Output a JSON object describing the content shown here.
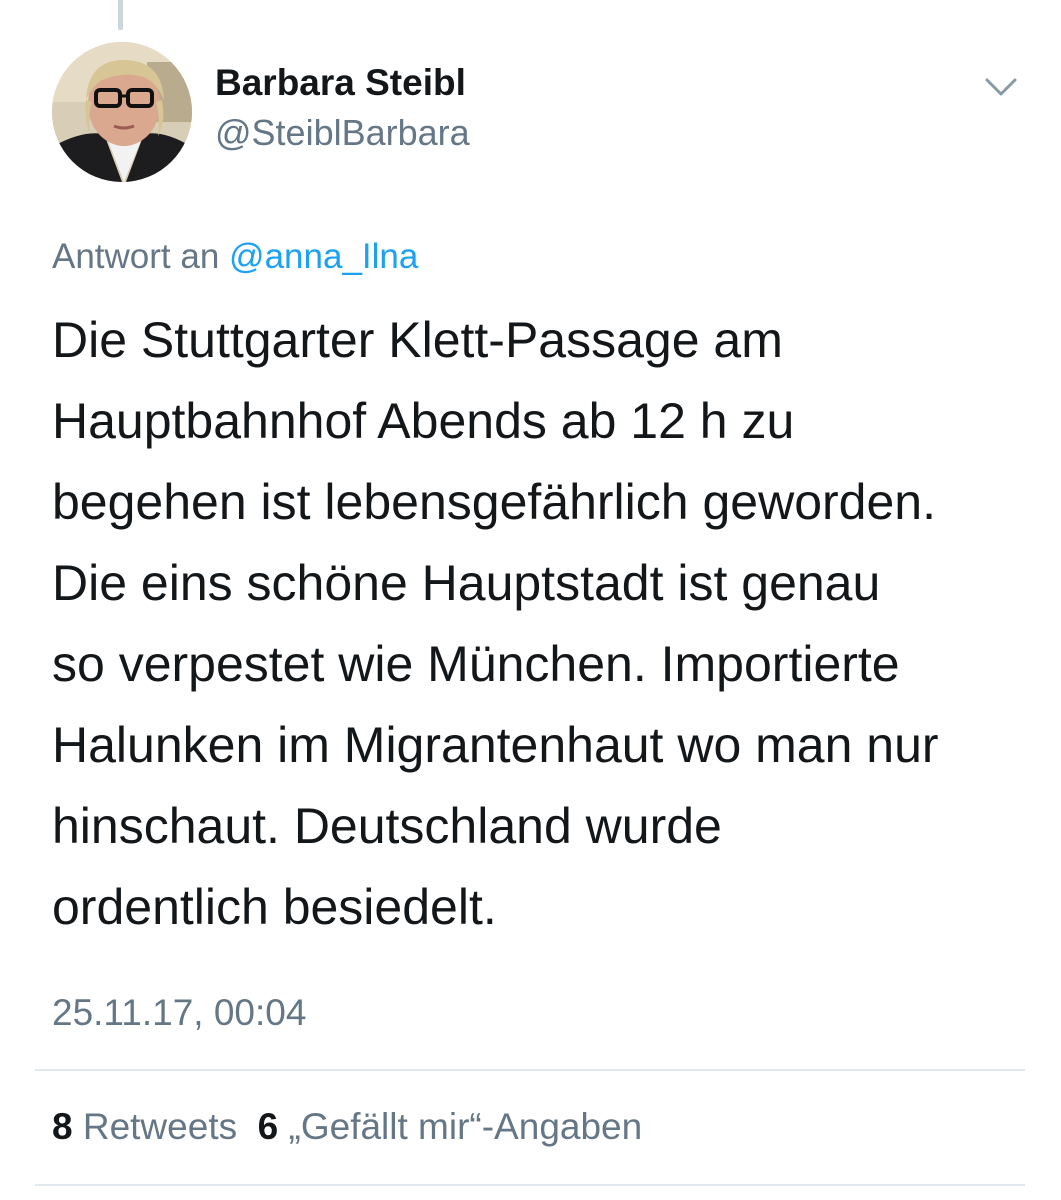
{
  "tweet": {
    "author": {
      "display_name": "Barbara Steibl",
      "handle": "@SteiblBarbara"
    },
    "reply": {
      "prefix": "Antwort an",
      "mention": "@anna_Ilna"
    },
    "text": "Die Stuttgarter Klett-Passage am\nHauptbahnhof Abends ab 12 h zu\nbegehen ist lebensgefährlich geworden.\nDie eins schöne Hauptstadt ist genau\nso verpestet wie München. Importierte\nHalunken im Migrantenhaut wo man nur\nhinschaut. Deutschland wurde\nordentlich besiedelt.",
    "timestamp": "25.11.17, 00:04",
    "stats": {
      "retweets_count": "8",
      "retweets_label": "Retweets",
      "likes_count": "6",
      "likes_label": "„Gefällt mir“-Angaben"
    }
  },
  "icons": {
    "menu": "chevron-down-icon",
    "avatar": "avatar-photo"
  },
  "colors": {
    "text": "#14171a",
    "secondary": "#657786",
    "link": "#1da1f2",
    "divider": "#e1e8ed"
  }
}
